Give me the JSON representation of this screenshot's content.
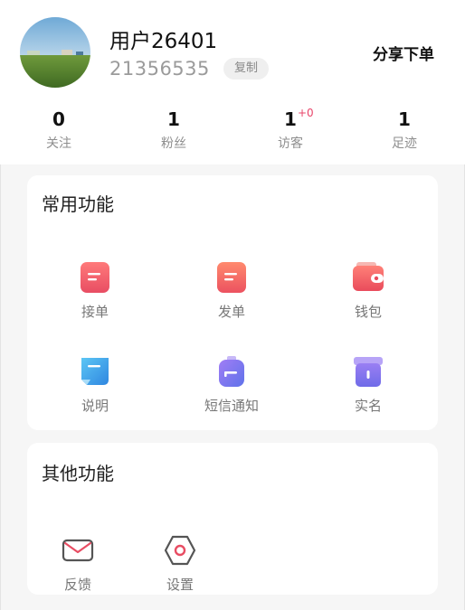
{
  "profile": {
    "username": "用户26401",
    "user_id": "21356535",
    "copy_label": "复制",
    "share_label": "分享下单"
  },
  "stats": [
    {
      "value": "0",
      "label": "关注"
    },
    {
      "value": "1",
      "label": "粉丝"
    },
    {
      "value": "1",
      "label": "访客",
      "badge": "+0"
    },
    {
      "value": "1",
      "label": "足迹"
    }
  ],
  "common": {
    "title": "常用功能",
    "items": [
      {
        "label": "接单",
        "icon": "receive-order-icon"
      },
      {
        "label": "发单",
        "icon": "post-order-icon"
      },
      {
        "label": "钱包",
        "icon": "wallet-icon"
      },
      {
        "label": "说明",
        "icon": "instructions-icon"
      },
      {
        "label": "短信通知",
        "icon": "sms-notification-icon"
      },
      {
        "label": "实名",
        "icon": "real-name-icon"
      }
    ]
  },
  "other": {
    "title": "其他功能",
    "items": [
      {
        "label": "反馈",
        "icon": "mail-icon"
      },
      {
        "label": "设置",
        "icon": "settings-icon"
      }
    ]
  },
  "colors": {
    "accent_red": "#f05a66",
    "accent_blue": "#3f9dea",
    "accent_purple": "#8a6cf0",
    "badge_pink": "#e8456a"
  }
}
